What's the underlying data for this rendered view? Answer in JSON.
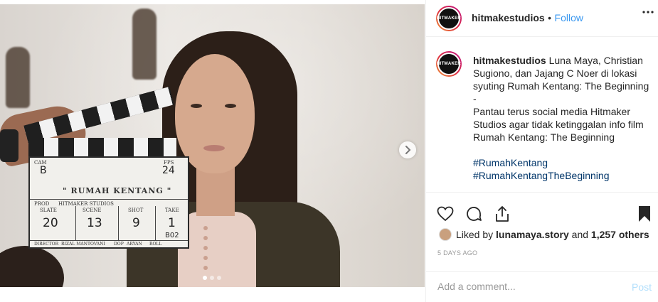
{
  "post": {
    "username": "hitmakestudios",
    "separator": "•",
    "follow_label": "Follow",
    "avatar_text": "HITMAKER",
    "more_icon": "more-dots-icon"
  },
  "media": {
    "slate": {
      "cam_label": "CAM",
      "cam_value": "B",
      "fps_label": "FPS",
      "fps_value": "24",
      "title": "\" RUMAH KENTANG \"",
      "prod_label": "PROD",
      "prod_value": "HITMAKER STUDIOS",
      "slate_label": "SLATE",
      "scene_label": "SCENE",
      "shot_label": "SHOT",
      "take_label": "TAKE",
      "slate_value": "20",
      "scene_value": "13",
      "shot_value": "9",
      "take_value": "1",
      "director_label": "DIRECTOR",
      "director_value": "RIZAL MANTOVANI",
      "dop_label": "DOP",
      "dop_value": "ARYAN",
      "roll_label": "ROLL",
      "roll_value": "B02"
    },
    "carousel_count": 3,
    "carousel_active": 0
  },
  "caption": {
    "username": "hitmakestudios",
    "text_1": "Luna Maya, Christian Sugiono, dan Jajang C Noer di lokasi syuting Rumah Kentang: The Beginning",
    "separator": "-",
    "text_2": "Pantau terus social media Hitmaker Studios agar tidak ketinggalan info film Rumah Kentang: The Beginning",
    "hashtag_1": "#RumahKentang",
    "hashtag_2": "#RumahKentangTheBeginning"
  },
  "likes": {
    "prefix": "Liked by",
    "user": "lunamaya.story",
    "middle": "and",
    "others": "1,257 others"
  },
  "timestamp": "5 DAYS AGO",
  "comment_box": {
    "placeholder": "Add a comment...",
    "post_label": "Post"
  },
  "colors": {
    "link_blue": "#3897f0",
    "post_disabled": "#b2dffc",
    "hashtag": "#003569"
  }
}
